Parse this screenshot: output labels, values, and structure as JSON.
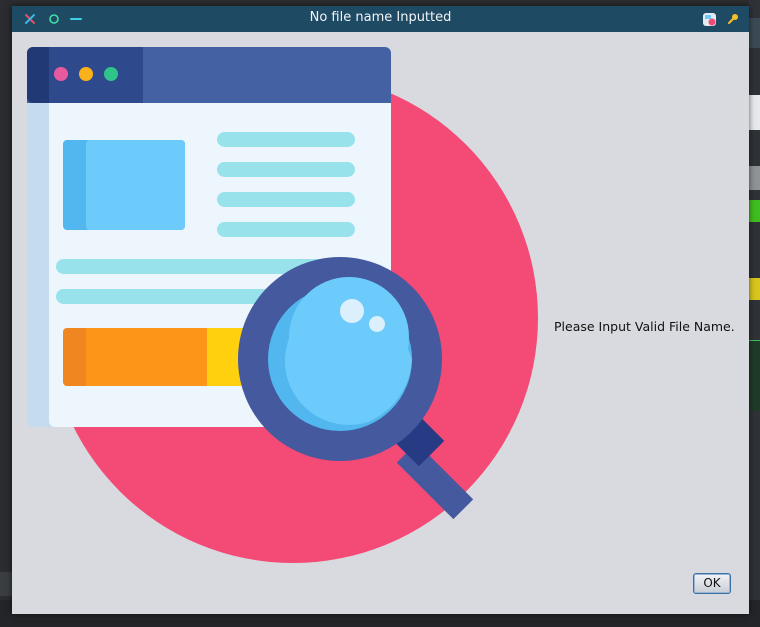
{
  "window": {
    "title": "No file name Inputted"
  },
  "dialog": {
    "message": "Please Input Valid File Name.",
    "ok_label": "OK"
  },
  "colors": {
    "titlebar": "#1f4a63",
    "dialog_background": "#d8dae0",
    "circle": "#f44a76",
    "magnifier_frame": "#44599e",
    "lens": "#6ccbfb",
    "browser_header": "#4461a4",
    "bar_orange": "#fd9519",
    "bar_yellow": "#ffd00e"
  },
  "icons": {
    "close": "close-icon",
    "maximize": "maximize-icon",
    "minimize": "minimize-icon",
    "app": "app-icon",
    "pin": "pin-icon",
    "illustration": "file-search-illustration"
  }
}
